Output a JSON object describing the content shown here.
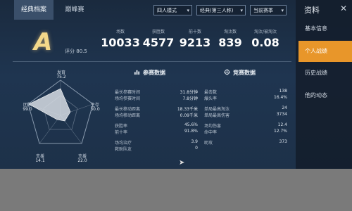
{
  "tabs": [
    "经典档案",
    "巅峰赛"
  ],
  "filters": {
    "mode": "四人模式",
    "perspective": "经典(第三人称)",
    "season": "当前赛季"
  },
  "sidebar": {
    "title": "资料",
    "items": [
      "基本信息",
      "个人战绩",
      "历史战绩",
      "他的动态"
    ]
  },
  "grade": {
    "letter": "A",
    "score_label": "评分",
    "score": "80.5"
  },
  "stats": [
    {
      "label": "场数",
      "value": "10033"
    },
    {
      "label": "获胜数",
      "value": "4577"
    },
    {
      "label": "前十数",
      "value": "9213"
    },
    {
      "label": "淘汰数",
      "value": "839"
    },
    {
      "label": "淘汰/被淘汰",
      "value": "0.08"
    }
  ],
  "radar": {
    "axes": [
      {
        "label": "发育",
        "value": "75.2"
      },
      {
        "label": "生存",
        "value": "30.0"
      },
      {
        "label": "支援",
        "value": "22.0"
      },
      {
        "label": "支援",
        "value": "14.1"
      },
      {
        "label": "团队",
        "value": "99.0"
      }
    ]
  },
  "sections": {
    "participation": "参赛数据",
    "competition": "竞赛数据"
  },
  "participation_rows": [
    {
      "k": "最长参赛时间",
      "v": "31.8分钟"
    },
    {
      "k": "场均参赛时间",
      "v": "7.8分钟"
    },
    null,
    {
      "k": "最长移动距离",
      "v": "18.33千米"
    },
    {
      "k": "场均移动距离",
      "v": "0.09千米"
    },
    null,
    {
      "k": "获胜率",
      "v": "45.6%"
    },
    {
      "k": "前十率",
      "v": "91.8%"
    },
    null,
    {
      "k": "场均治疗",
      "v": "3.9"
    },
    {
      "k": "救助队友",
      "v": "0"
    }
  ],
  "competition_rows": [
    {
      "k": "最击数",
      "v": "138"
    },
    {
      "k": "爆头率",
      "v": "16.4%"
    },
    null,
    {
      "k": "单局最高淘汰",
      "v": "24"
    },
    {
      "k": "单局最高伤害",
      "v": "3734"
    },
    null,
    {
      "k": "场均伤害",
      "v": "12.4"
    },
    {
      "k": "命中率",
      "v": "12.7%"
    },
    null,
    {
      "k": "助攻",
      "v": "373"
    }
  ],
  "colors": {
    "accent": "#e8962a",
    "panel": "#1f3550",
    "grade": "#f3d88a"
  }
}
